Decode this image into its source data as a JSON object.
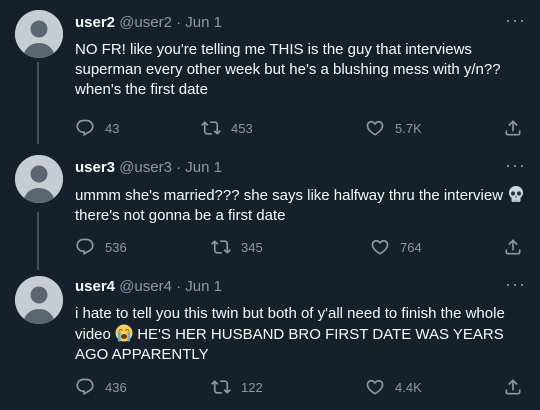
{
  "tweets": [
    {
      "name": "user2",
      "handle": "@user2",
      "dot": "·",
      "date": "Jun 1",
      "more": "···",
      "text": "NO FR! like you're telling me THIS is the guy that interviews superman every other week but he's a blushing mess with y/n?? when's the first date",
      "replies": "43",
      "retweets": "453",
      "likes": "5.7K"
    },
    {
      "name": "user3",
      "handle": "@user3",
      "dot": "·",
      "date": "Jun 1",
      "more": "···",
      "text_before": "ummm she's married??? she says like halfway thru the interview",
      "emoji": "skull",
      "text_after": " there's not gonna be a first date",
      "replies": "536",
      "retweets": "345",
      "likes": "764"
    },
    {
      "name": "user4",
      "handle": "@user4",
      "dot": "·",
      "date": "Jun 1",
      "more": "···",
      "text_before": "i hate to tell you this twin but both of y'all need to finish the whole video ",
      "emoji": "loudly-crying-face",
      "text_after": " HE'S HER HUSBAND BRO FIRST DATE WAS YEARS AGO APPARENTLY",
      "replies": "436",
      "retweets": "122",
      "likes": "4.4K"
    }
  ],
  "icons": {
    "reply": "reply-icon",
    "retweet": "retweet-icon",
    "like": "like-icon",
    "share": "share-icon"
  },
  "colors": {
    "background": "#15202b",
    "muted": "#8b98a5",
    "avatar": "#c7cdd2"
  }
}
